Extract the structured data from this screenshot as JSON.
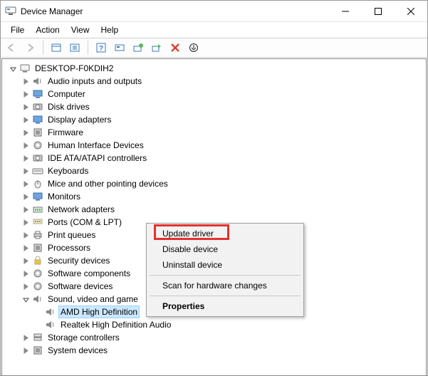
{
  "window": {
    "title": "Device Manager"
  },
  "menu": {
    "file": "File",
    "action": "Action",
    "view": "View",
    "help": "Help"
  },
  "tree": {
    "root": "DESKTOP-F0KDIH2",
    "categories": [
      "Audio inputs and outputs",
      "Computer",
      "Disk drives",
      "Display adapters",
      "Firmware",
      "Human Interface Devices",
      "IDE ATA/ATAPI controllers",
      "Keyboards",
      "Mice and other pointing devices",
      "Monitors",
      "Network adapters",
      "Ports (COM & LPT)",
      "Print queues",
      "Processors",
      "Security devices",
      "Software components",
      "Software devices",
      "Sound, video and game",
      "Storage controllers",
      "System devices"
    ],
    "sound_children": [
      "AMD High Definition",
      "Realtek High Definition Audio"
    ]
  },
  "context_menu": {
    "update": "Update driver",
    "disable": "Disable device",
    "uninstall": "Uninstall device",
    "scan": "Scan for hardware changes",
    "properties": "Properties"
  }
}
